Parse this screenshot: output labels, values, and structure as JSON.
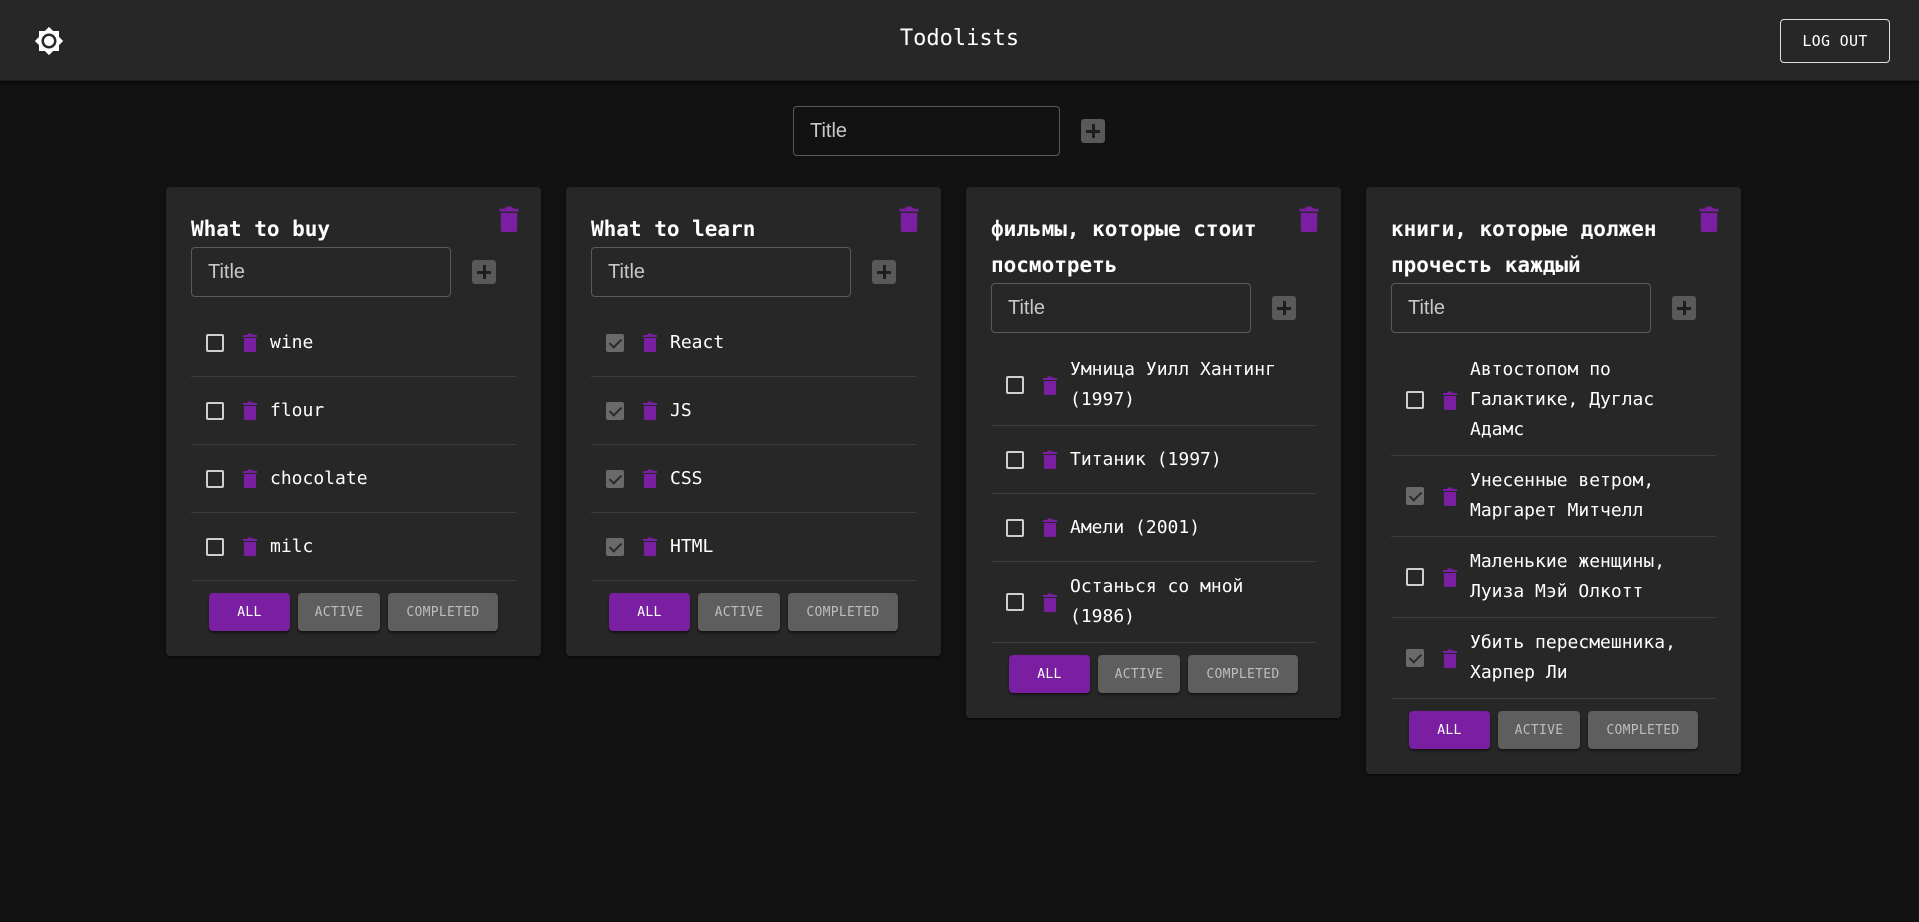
{
  "app": {
    "title": "Todolists",
    "logout_label": "LOG OUT",
    "accent_color": "#7b1fa2"
  },
  "new_list": {
    "placeholder": "Title"
  },
  "filters": {
    "all": "ALL",
    "active": "ACTIVE",
    "completed": "COMPLETED"
  },
  "lists": [
    {
      "title": "What to buy",
      "placeholder": "Title",
      "tasks": [
        {
          "label": "wine",
          "done": false
        },
        {
          "label": "flour",
          "done": false
        },
        {
          "label": "chocolate",
          "done": false
        },
        {
          "label": "milc",
          "done": false
        }
      ]
    },
    {
      "title": "What to learn",
      "placeholder": "Title",
      "tasks": [
        {
          "label": "React",
          "done": true
        },
        {
          "label": "JS",
          "done": true
        },
        {
          "label": "CSS",
          "done": true
        },
        {
          "label": "HTML",
          "done": true
        }
      ]
    },
    {
      "title": "фильмы, которые стоит посмотреть",
      "placeholder": "Title",
      "tasks": [
        {
          "label": "Умница Уилл Хантинг (1997)",
          "done": false
        },
        {
          "label": "Титаник (1997)",
          "done": false
        },
        {
          "label": "Амели (2001)",
          "done": false
        },
        {
          "label": "Останься со мной (1986)",
          "done": false
        }
      ]
    },
    {
      "title": "книги, которые должен прочесть каждый",
      "placeholder": "Title",
      "tasks": [
        {
          "label": "Автостопом по Галактике, Дуглас Адамс",
          "done": false
        },
        {
          "label": "Унесенные ветром, Маргарет Митчелл",
          "done": true
        },
        {
          "label": "Маленькие женщины, Луиза Мэй Олкотт",
          "done": false
        },
        {
          "label": "Убить пересмешника, Харпер Ли",
          "done": true
        }
      ]
    }
  ]
}
